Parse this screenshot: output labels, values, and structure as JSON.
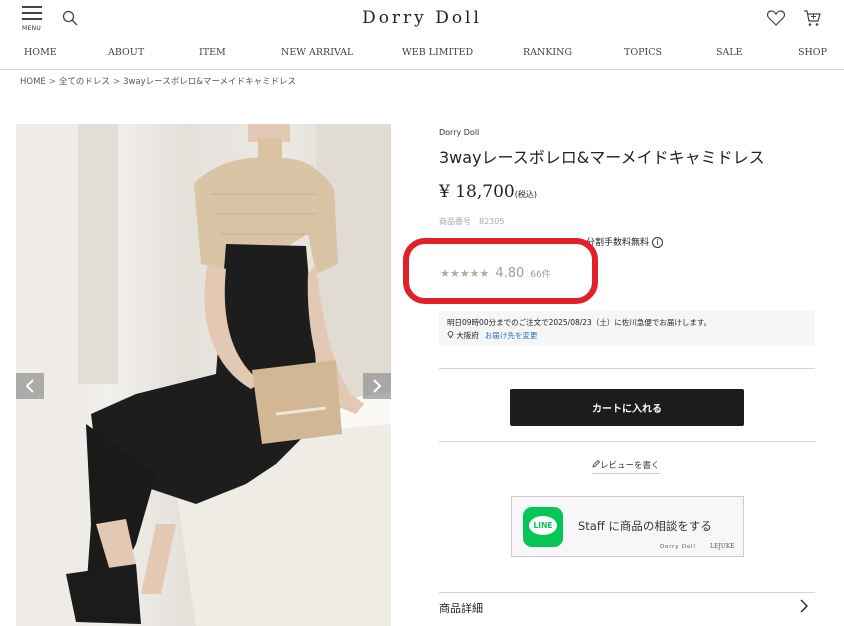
{
  "header": {
    "menu_label": "MENU",
    "logo": "Dorry Doll"
  },
  "nav": [
    "HOME",
    "ABOUT",
    "ITEM",
    "NEW ARRIVAL",
    "WEB LIMITED",
    "RANKING",
    "TOPICS",
    "SALE",
    "SHOP"
  ],
  "breadcrumb": [
    "HOME",
    "全てのドレス",
    "3wayレースボレロ&マーメイドキャミドレス"
  ],
  "product": {
    "brand": "Dorry Doll",
    "title": "3wayレースボレロ&マーメイドキャミドレス",
    "price": "¥ 18,700",
    "tax_note": "(税込)",
    "code": "商品番号　82305",
    "installment_note": "分割手数料無料",
    "rating_stars": "★★★★★",
    "rating_score": "4.80",
    "rating_count": "66件"
  },
  "delivery": {
    "message": "明日09時00分までのご注文で2025/08/23（土）に佐川急便でお届けします。",
    "location": "大阪府",
    "change_label": "お届け先を変更"
  },
  "actions": {
    "cart_button": "カートに入れる",
    "review_link": "レビューを書く"
  },
  "line_banner": {
    "logo_text": "LINE",
    "text": "Staff に商品の相談をする",
    "brand1": "Dorry Doll",
    "brand2": "LEJUKE"
  },
  "details": {
    "label": "商品詳細"
  },
  "colors": {
    "highlight": "#e0202a",
    "line_green": "#06c755",
    "cart_button_bg": "#1c1c1c",
    "link_blue": "#2a6fb5",
    "rating_color": "#a89f8a"
  }
}
